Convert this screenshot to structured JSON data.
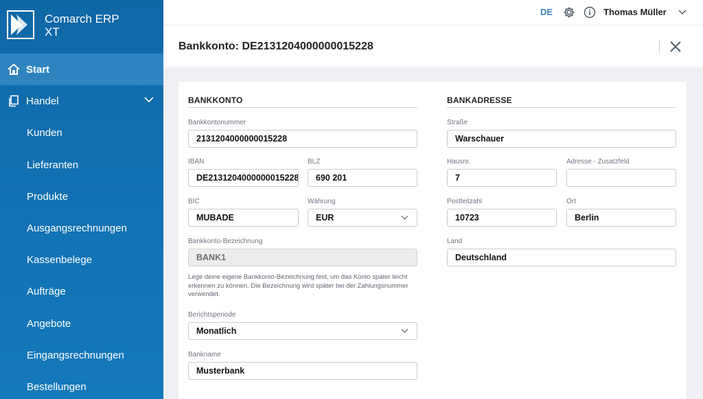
{
  "app": {
    "logo_line1": "Comarch ERP",
    "logo_line2": "XT"
  },
  "sidebar": {
    "items": [
      {
        "label": "Start",
        "icon": "home-icon",
        "active": true
      },
      {
        "label": "Handel",
        "icon": "documents-icon",
        "expanded": true
      },
      {
        "label": "Kunden"
      },
      {
        "label": "Lieferanten"
      },
      {
        "label": "Produkte"
      },
      {
        "label": "Ausgangsrechnungen"
      },
      {
        "label": "Kassenbelege"
      },
      {
        "label": "Aufträge"
      },
      {
        "label": "Angebote"
      },
      {
        "label": "Eingangsrechnungen"
      },
      {
        "label": "Bestellungen"
      }
    ]
  },
  "topbar": {
    "language": "DE",
    "user_name": "Thomas Müller"
  },
  "dialog": {
    "title": "Bankkonto: DE2131204000000015228"
  },
  "bankkonto": {
    "section_title": "BANKKONTO",
    "account_number_label": "Bankkontonummer",
    "account_number": "2131204000000015228",
    "iban_label": "IBAN",
    "iban": "DE2131204000000015228",
    "blz_label": "BLZ",
    "blz": "690 201",
    "bic_label": "BIC",
    "bic": "MUBADE",
    "currency_label": "Währung",
    "currency": "EUR",
    "designation_label": "Bankkonto-Bezeichnung",
    "designation": "BANK1",
    "help_text": "Lege deine eigene Bankkonto-Bezeichnung fest, um das Konto später leicht erkennen zu können. Die Bezeichnung wird später bei der Zahlungsnummer verwendet.",
    "period_label": "Berichtsperiode",
    "period": "Monatlich",
    "bank_name_label": "Bankname",
    "bank_name": "Musterbank"
  },
  "bankadresse": {
    "section_title": "BANKADRESSE",
    "street_label": "Straße",
    "street": "Warschauer",
    "house_no_label": "Hausnr.",
    "house_no": "7",
    "address_extra_label": "Adresse - Zusatzfeld",
    "address_extra": "",
    "zip_label": "Postleitzahl",
    "zip": "10723",
    "city_label": "Ort",
    "city": "Berlin",
    "country_label": "Land",
    "country": "Deutschland"
  },
  "colors": {
    "sidebar": "#1273b5",
    "sidebar_active": "#2f84c0",
    "accent": "#3e7fb8"
  }
}
